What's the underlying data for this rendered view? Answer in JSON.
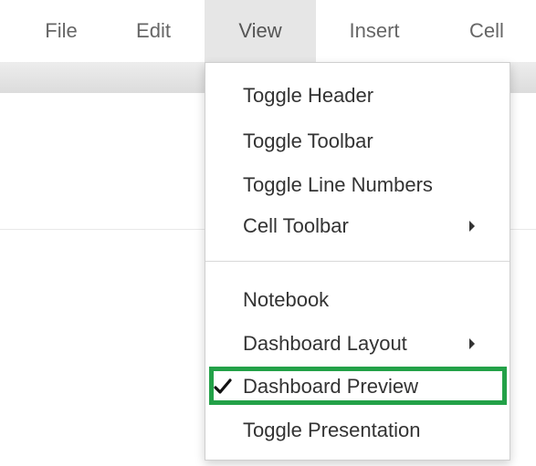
{
  "menubar": {
    "items": [
      {
        "label": "File"
      },
      {
        "label": "Edit"
      },
      {
        "label": "View"
      },
      {
        "label": "Insert"
      },
      {
        "label": "Cell"
      }
    ],
    "active": "View"
  },
  "view_menu": {
    "items": [
      {
        "label": "Toggle Header"
      },
      {
        "label": "Toggle Toolbar"
      },
      {
        "label": "Toggle Line Numbers"
      },
      {
        "label": "Cell Toolbar",
        "submenu": true
      },
      {
        "label": "Notebook"
      },
      {
        "label": "Dashboard Layout",
        "submenu": true
      },
      {
        "label": "Dashboard Preview",
        "checked": true,
        "highlighted": true
      },
      {
        "label": "Toggle Presentation"
      }
    ]
  },
  "colors": {
    "highlight_border": "#23a148",
    "active_menu_bg": "#e6e6e6"
  },
  "icons": {
    "checkmark": "check-icon",
    "submenu": "caret-right-icon"
  }
}
